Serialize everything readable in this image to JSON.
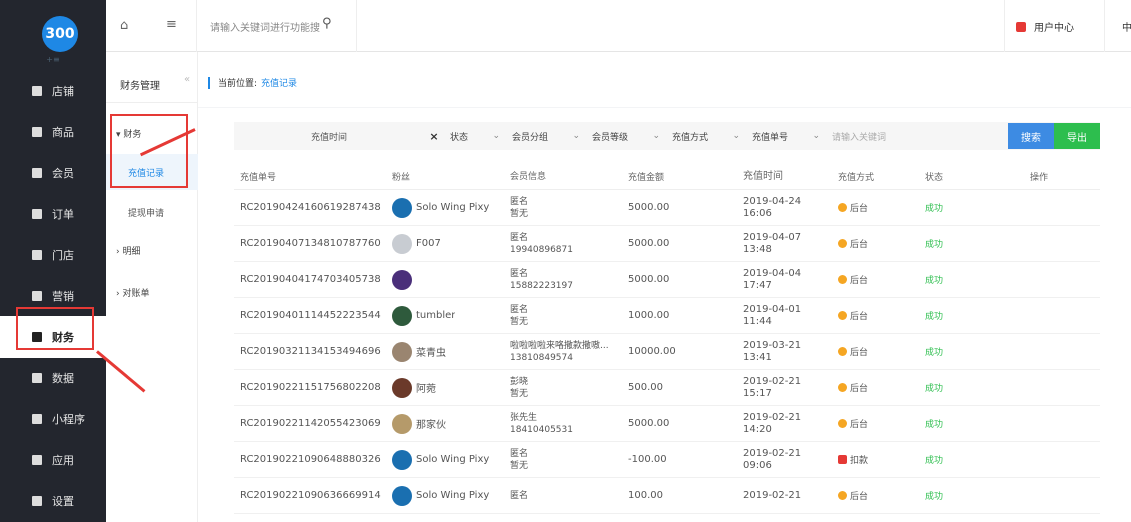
{
  "logo": "300",
  "sidebar": {
    "items": [
      {
        "label": "店铺",
        "icon": "store-icon"
      },
      {
        "label": "商品",
        "icon": "goods-icon"
      },
      {
        "label": "会员",
        "icon": "member-icon"
      },
      {
        "label": "订单",
        "icon": "order-icon"
      },
      {
        "label": "门店",
        "icon": "shop-icon"
      },
      {
        "label": "营销",
        "icon": "marketing-icon"
      },
      {
        "label": "财务",
        "icon": "finance-icon",
        "active": true
      },
      {
        "label": "数据",
        "icon": "data-icon"
      },
      {
        "label": "小程序",
        "icon": "miniprogram-icon"
      },
      {
        "label": "应用",
        "icon": "apps-icon"
      },
      {
        "label": "设置",
        "icon": "settings-icon"
      }
    ]
  },
  "topbar": {
    "search_placeholder": "请输入关键词进行功能搜",
    "user_center": "用户中心",
    "lang_cut": "中"
  },
  "submenu": {
    "title": "财务管理",
    "collapse": "«",
    "group1": "▾ 财务",
    "item_recharge": "充值记录",
    "item_withdraw": "提现申请",
    "group2": "› 明细",
    "group3": "› 对账单"
  },
  "breadcrumb": {
    "prefix": "当前位置:",
    "current": "充值记录"
  },
  "filters": {
    "date": "充值时间",
    "clear": "×",
    "status": "状态",
    "member_group": "会员分组",
    "member_level": "会员等级",
    "recharge_method": "充值方式",
    "recharge_no": "充值单号",
    "keyword_placeholder": "请输入关键词",
    "search_btn": "搜索",
    "export_btn": "导出"
  },
  "table": {
    "headers": [
      "充值单号",
      "粉丝",
      "会员信息",
      "充值金额",
      "充值时间",
      "充值方式",
      "状态",
      "操作"
    ],
    "rows": [
      {
        "no": "RC20190424160619287438",
        "fan": "Solo Wing Pixy",
        "avatar_color": "#1a6fb0",
        "m1": "匿名",
        "m2": "暂无",
        "amount": "5000.00",
        "date": "2019-04-24",
        "time": "16:06",
        "method": "后台",
        "method_type": "backend",
        "status": "成功"
      },
      {
        "no": "RC20190407134810787760",
        "fan": "F007",
        "avatar_color": "#c8ccd2",
        "m1": "匿名",
        "m2": "19940896871",
        "amount": "5000.00",
        "date": "2019-04-07",
        "time": "13:48",
        "method": "后台",
        "method_type": "backend",
        "status": "成功"
      },
      {
        "no": "RC20190404174703405738",
        "fan": "",
        "avatar_color": "#4a2f7a",
        "m1": "匿名",
        "m2": "15882223197",
        "amount": "5000.00",
        "date": "2019-04-04",
        "time": "17:47",
        "method": "后台",
        "method_type": "backend",
        "status": "成功"
      },
      {
        "no": "RC20190401114452223544",
        "fan": "tumbler",
        "avatar_color": "#2e5a3c",
        "m1": "匿名",
        "m2": "暂无",
        "amount": "1000.00",
        "date": "2019-04-01",
        "time": "11:44",
        "method": "后台",
        "method_type": "backend",
        "status": "成功"
      },
      {
        "no": "RC20190321134153494696",
        "fan": "菜青虫",
        "avatar_color": "#9a8570",
        "m1": "啦啦啦啦来咯撒款撒嗷...",
        "m2": "13810849574",
        "amount": "10000.00",
        "date": "2019-03-21",
        "time": "13:41",
        "method": "后台",
        "method_type": "backend",
        "status": "成功"
      },
      {
        "no": "RC20190221151756802208",
        "fan": "阿菀",
        "avatar_color": "#6b3a2a",
        "m1": "彭晓",
        "m2": "暂无",
        "amount": "500.00",
        "date": "2019-02-21",
        "time": "15:17",
        "method": "后台",
        "method_type": "backend",
        "status": "成功"
      },
      {
        "no": "RC20190221142055423069",
        "fan": "那家伙",
        "avatar_color": "#b59a6a",
        "m1": "张先生",
        "m2": "18410405531",
        "amount": "5000.00",
        "date": "2019-02-21",
        "time": "14:20",
        "method": "后台",
        "method_type": "backend",
        "status": "成功"
      },
      {
        "no": "RC20190221090648880326",
        "fan": "Solo Wing Pixy",
        "avatar_color": "#1a6fb0",
        "m1": "匿名",
        "m2": "暂无",
        "amount": "-100.00",
        "date": "2019-02-21",
        "time": "09:06",
        "method": "扣款",
        "method_type": "deduct",
        "status": "成功"
      },
      {
        "no": "RC20190221090636669914",
        "fan": "Solo Wing Pixy",
        "avatar_color": "#1a6fb0",
        "m1": "匿名",
        "m2": "",
        "amount": "100.00",
        "date": "2019-02-21",
        "time": "",
        "method": "后台",
        "method_type": "backend",
        "status": "成功"
      }
    ]
  }
}
